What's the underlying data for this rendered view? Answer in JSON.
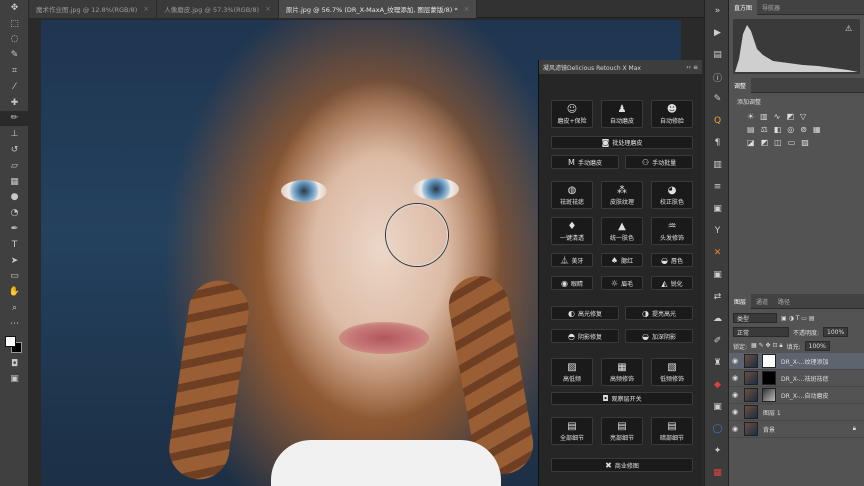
{
  "tabs": [
    {
      "label": "魔术作业图.jpg @ 12.8%(RGB/8)",
      "close": "×"
    },
    {
      "label": "人像磨皮.jpg @ 57.3%(RGB/8)",
      "close": "×"
    },
    {
      "label": "原片.jpg @ 56.7% (DR_X-MaxA_纹理添加, 图层蒙版/8) *",
      "close": "×"
    }
  ],
  "tools": [
    "move",
    "marquee",
    "lasso",
    "quick-select",
    "crop",
    "eyedropper",
    "healing",
    "brush",
    "stamp",
    "history-brush",
    "eraser",
    "gradient",
    "blur",
    "dodge",
    "pen",
    "type",
    "path-select",
    "shape",
    "hand",
    "zoom"
  ],
  "plugin": {
    "title": "凝风滤镜Delicious Retouch X Max",
    "controls": "›› ≡",
    "buttons": {
      "b1": "磨皮+保险",
      "b2": "自动磨皮",
      "b3": "自动修脸",
      "b4": "批处理磨皮",
      "b5": "手动磨皮",
      "b6": "手动批量",
      "b7": "祛斑祛痣",
      "b8": "皮肤纹理",
      "b9": "校正肤色",
      "b10": "一键清透",
      "b11": "统一肤色",
      "b12": "头发修饰",
      "b13": "美牙",
      "b14": "腮红",
      "b15": "唇色",
      "b16": "眼睛",
      "b17": "眉毛",
      "b18": "锐化",
      "b19": "高光修复",
      "b20": "提亮高光",
      "b21": "阴影修复",
      "b22": "加深阴影",
      "b23": "高低频",
      "b24": "高频修饰",
      "b25": "低频修饰",
      "b26": "观察层开关",
      "b27": "全部细节",
      "b28": "亮部细节",
      "b29": "暗部细节",
      "b30": "商业修图"
    }
  },
  "right": {
    "tabs1": [
      "直方图",
      "导航器"
    ],
    "tabs2": [
      "调整"
    ],
    "adj_title": "添加调整",
    "layer_tabs": [
      "图层",
      "通道",
      "路径"
    ],
    "filter": "类型",
    "blend": "正常",
    "opacity_label": "不透明度:",
    "opacity": "100%",
    "lock_label": "锁定:",
    "fill_label": "填充:",
    "fill": "100%",
    "layers": [
      "DR_X-...纹理添加",
      "DR_X-...祛斑祛痣",
      "DR_X-...自动磨皮",
      "图层 1",
      "背景"
    ]
  }
}
